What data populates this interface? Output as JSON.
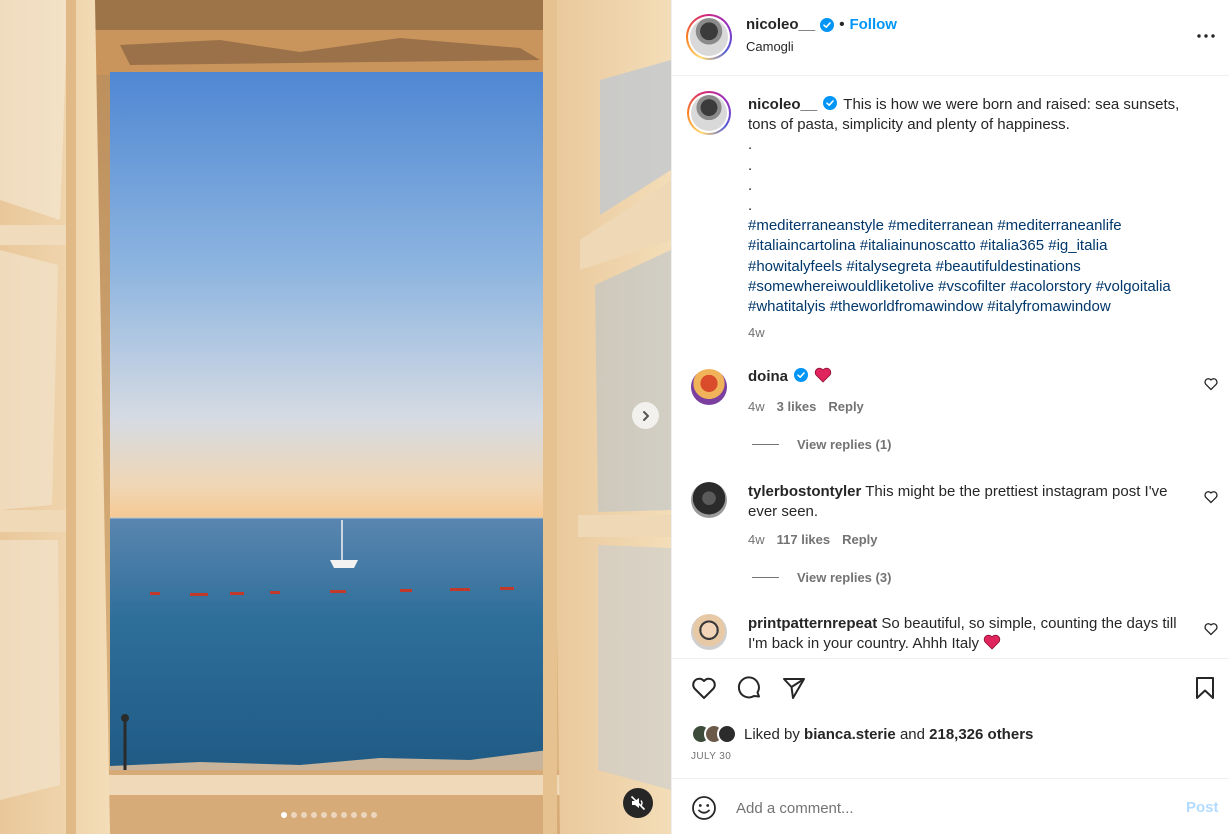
{
  "post": {
    "author": "nicoleo__",
    "follow_label": "Follow",
    "separator": "•",
    "location": "Camogli",
    "caption_text": "This is how we were born and raised: sea sunsets, tons of pasta, simplicity and plenty of happiness.",
    "caption_dots": [
      ".",
      ".",
      ".",
      "."
    ],
    "hashtags_lines": [
      [
        "#mediterraneanstyle",
        "#mediterranean",
        "#mediterraneanlife"
      ],
      [
        "#italiaincartolina",
        "#italiainunoscatto",
        "#italia365",
        "#ig_italia"
      ],
      [
        "#howitalyfeels",
        "#italysegreta",
        "#beautifuldestinations"
      ],
      [
        "#somewhereiwouldliketolive",
        "#vscofilter",
        "#acolorstory",
        "#volgoitalia"
      ],
      [
        "#whatitalyis",
        "#theworldfromawindow",
        "#italyfromawindow"
      ]
    ],
    "caption_time": "4w"
  },
  "comments": [
    {
      "user": "doina",
      "verified": true,
      "text": "",
      "heart_emoji": true,
      "time": "4w",
      "likes": "3 likes",
      "reply": "Reply",
      "view_replies": "View replies (1)"
    },
    {
      "user": "tylerbostontyler",
      "verified": false,
      "text": "This might be the prettiest instagram post I've ever seen.",
      "time": "4w",
      "likes": "117 likes",
      "reply": "Reply",
      "view_replies": "View replies (3)"
    },
    {
      "user": "printpatternrepeat",
      "verified": false,
      "text": "So beautiful, so simple, counting the days till I'm back in your country. Ahhh Italy",
      "heart_emoji": true
    }
  ],
  "likes": {
    "prefix": "Liked by",
    "user": "bianca.sterie",
    "and": "and",
    "others": "218,326 others"
  },
  "date": "JULY 30",
  "add_comment": {
    "placeholder": "Add a comment...",
    "post_label": "Post"
  },
  "carousel": {
    "count": 10,
    "active_index": 0
  },
  "icons": [
    "more-options-icon",
    "verified-badge-icon",
    "like-icon",
    "comment-icon",
    "share-icon",
    "save-icon",
    "emoji-icon",
    "mute-icon",
    "next-arrow-icon",
    "small-heart-icon"
  ],
  "colors": {
    "accent": "#0095f6",
    "hashtag": "#00376b",
    "muted": "#737373",
    "heart": "#ff3040"
  }
}
